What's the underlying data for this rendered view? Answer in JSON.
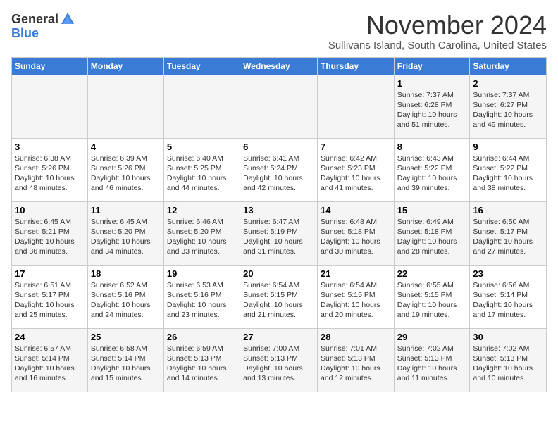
{
  "header": {
    "logo_general": "General",
    "logo_blue": "Blue",
    "month": "November 2024",
    "location": "Sullivans Island, South Carolina, United States"
  },
  "days_of_week": [
    "Sunday",
    "Monday",
    "Tuesday",
    "Wednesday",
    "Thursday",
    "Friday",
    "Saturday"
  ],
  "weeks": [
    [
      {
        "day": "",
        "info": ""
      },
      {
        "day": "",
        "info": ""
      },
      {
        "day": "",
        "info": ""
      },
      {
        "day": "",
        "info": ""
      },
      {
        "day": "",
        "info": ""
      },
      {
        "day": "1",
        "info": "Sunrise: 7:37 AM\nSunset: 6:28 PM\nDaylight: 10 hours and 51 minutes."
      },
      {
        "day": "2",
        "info": "Sunrise: 7:37 AM\nSunset: 6:27 PM\nDaylight: 10 hours and 49 minutes."
      }
    ],
    [
      {
        "day": "3",
        "info": "Sunrise: 6:38 AM\nSunset: 5:26 PM\nDaylight: 10 hours and 48 minutes."
      },
      {
        "day": "4",
        "info": "Sunrise: 6:39 AM\nSunset: 5:26 PM\nDaylight: 10 hours and 46 minutes."
      },
      {
        "day": "5",
        "info": "Sunrise: 6:40 AM\nSunset: 5:25 PM\nDaylight: 10 hours and 44 minutes."
      },
      {
        "day": "6",
        "info": "Sunrise: 6:41 AM\nSunset: 5:24 PM\nDaylight: 10 hours and 42 minutes."
      },
      {
        "day": "7",
        "info": "Sunrise: 6:42 AM\nSunset: 5:23 PM\nDaylight: 10 hours and 41 minutes."
      },
      {
        "day": "8",
        "info": "Sunrise: 6:43 AM\nSunset: 5:22 PM\nDaylight: 10 hours and 39 minutes."
      },
      {
        "day": "9",
        "info": "Sunrise: 6:44 AM\nSunset: 5:22 PM\nDaylight: 10 hours and 38 minutes."
      }
    ],
    [
      {
        "day": "10",
        "info": "Sunrise: 6:45 AM\nSunset: 5:21 PM\nDaylight: 10 hours and 36 minutes."
      },
      {
        "day": "11",
        "info": "Sunrise: 6:45 AM\nSunset: 5:20 PM\nDaylight: 10 hours and 34 minutes."
      },
      {
        "day": "12",
        "info": "Sunrise: 6:46 AM\nSunset: 5:20 PM\nDaylight: 10 hours and 33 minutes."
      },
      {
        "day": "13",
        "info": "Sunrise: 6:47 AM\nSunset: 5:19 PM\nDaylight: 10 hours and 31 minutes."
      },
      {
        "day": "14",
        "info": "Sunrise: 6:48 AM\nSunset: 5:18 PM\nDaylight: 10 hours and 30 minutes."
      },
      {
        "day": "15",
        "info": "Sunrise: 6:49 AM\nSunset: 5:18 PM\nDaylight: 10 hours and 28 minutes."
      },
      {
        "day": "16",
        "info": "Sunrise: 6:50 AM\nSunset: 5:17 PM\nDaylight: 10 hours and 27 minutes."
      }
    ],
    [
      {
        "day": "17",
        "info": "Sunrise: 6:51 AM\nSunset: 5:17 PM\nDaylight: 10 hours and 25 minutes."
      },
      {
        "day": "18",
        "info": "Sunrise: 6:52 AM\nSunset: 5:16 PM\nDaylight: 10 hours and 24 minutes."
      },
      {
        "day": "19",
        "info": "Sunrise: 6:53 AM\nSunset: 5:16 PM\nDaylight: 10 hours and 23 minutes."
      },
      {
        "day": "20",
        "info": "Sunrise: 6:54 AM\nSunset: 5:15 PM\nDaylight: 10 hours and 21 minutes."
      },
      {
        "day": "21",
        "info": "Sunrise: 6:54 AM\nSunset: 5:15 PM\nDaylight: 10 hours and 20 minutes."
      },
      {
        "day": "22",
        "info": "Sunrise: 6:55 AM\nSunset: 5:15 PM\nDaylight: 10 hours and 19 minutes."
      },
      {
        "day": "23",
        "info": "Sunrise: 6:56 AM\nSunset: 5:14 PM\nDaylight: 10 hours and 17 minutes."
      }
    ],
    [
      {
        "day": "24",
        "info": "Sunrise: 6:57 AM\nSunset: 5:14 PM\nDaylight: 10 hours and 16 minutes."
      },
      {
        "day": "25",
        "info": "Sunrise: 6:58 AM\nSunset: 5:14 PM\nDaylight: 10 hours and 15 minutes."
      },
      {
        "day": "26",
        "info": "Sunrise: 6:59 AM\nSunset: 5:13 PM\nDaylight: 10 hours and 14 minutes."
      },
      {
        "day": "27",
        "info": "Sunrise: 7:00 AM\nSunset: 5:13 PM\nDaylight: 10 hours and 13 minutes."
      },
      {
        "day": "28",
        "info": "Sunrise: 7:01 AM\nSunset: 5:13 PM\nDaylight: 10 hours and 12 minutes."
      },
      {
        "day": "29",
        "info": "Sunrise: 7:02 AM\nSunset: 5:13 PM\nDaylight: 10 hours and 11 minutes."
      },
      {
        "day": "30",
        "info": "Sunrise: 7:02 AM\nSunset: 5:13 PM\nDaylight: 10 hours and 10 minutes."
      }
    ]
  ]
}
